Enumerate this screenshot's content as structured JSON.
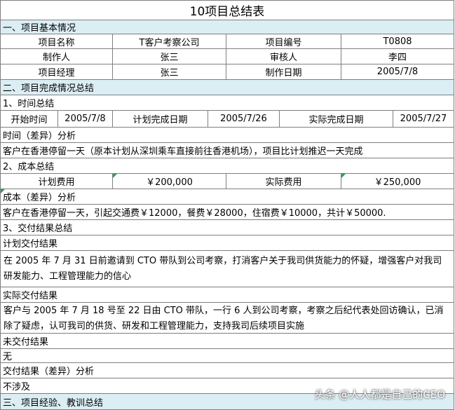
{
  "title": "10项目总结表",
  "sec1": {
    "heading": "一、项目基本情况",
    "rows": [
      [
        "项目名称",
        "T客户考察公司",
        "项目编号",
        "T0808"
      ],
      [
        "制作人",
        "张三",
        "审核人",
        "李四"
      ],
      [
        "项目经理",
        "张三",
        "制作日期",
        "2005/7/8"
      ]
    ]
  },
  "sec2": {
    "heading": "二、项目完成情况总结",
    "time": {
      "heading": "1、时间总结",
      "cells": [
        "开始时间",
        "2005/7/8",
        "计划完成日期",
        "2005/7/26",
        "实际完成日期",
        "2005/7/27"
      ],
      "diff_label": "时间（差异）分析",
      "diff_text": "客户在香港停留一天（原本计划从深圳乘车直接前往香港机场），项目比计划推迟一天完成"
    },
    "cost": {
      "heading": "2、成本总结",
      "cells": [
        "计划费用",
        "￥200,000",
        "实际费用",
        "￥250,000"
      ],
      "diff_label": "成本（差异）分析",
      "diff_text": "客户在香港停留一天，引起交通费￥12000，餐费￥28000，住宿费￥10000，共计￥50000."
    },
    "delivery": {
      "heading": "3、交付结果总结",
      "plan_label": "计划交付结果",
      "plan_text": "在 2005 年 7 月 31 日前邀请到 CTO 带队到公司考察，打消客户关于我司供货能力的怀疑，增强客户对我司研发能力、工程管理能力的信心",
      "actual_label": "实际交付结果",
      "actual_text": "客户与 2005 年 7 月 18 号至 22 日由 CTO 带队，一行 6 人到公司考察，考察之后纪代表处回访确认，已消除了疑虑，认可我司的供货、研发和工程管理能力，支持我司后续项目实施",
      "undelivered_label": "未交付结果",
      "undelivered_text": "无",
      "diff_label": "交付结果（差异）分析",
      "diff_text": "不涉及"
    }
  },
  "sec3": {
    "heading": "三、项目经验、教训总结"
  },
  "watermark": "头条 @人人都是自己的CEO"
}
